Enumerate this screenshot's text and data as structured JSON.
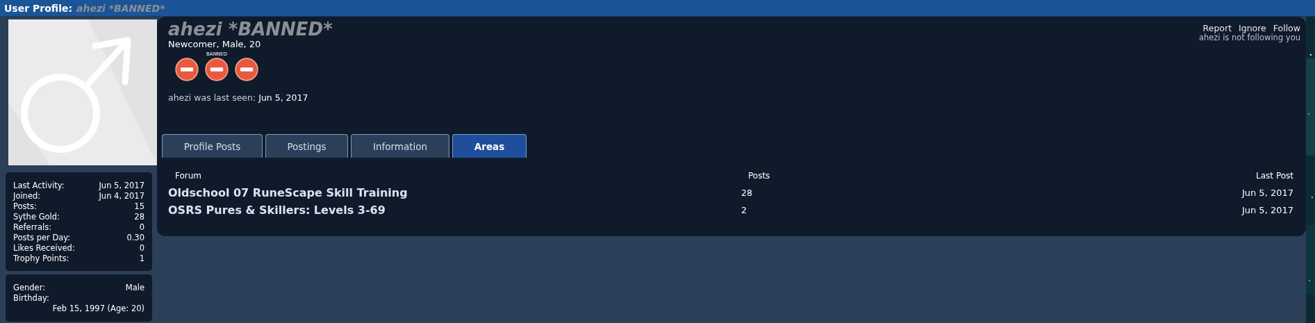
{
  "title_bar": {
    "label": "User Profile:",
    "name": "ahezi *BANNED*"
  },
  "stats": [
    {
      "label": "Last Activity:",
      "value": "Jun 5, 2017"
    },
    {
      "label": "Joined:",
      "value": "Jun 4, 2017"
    },
    {
      "label": "Posts:",
      "value": "15"
    },
    {
      "label": "Sythe Gold:",
      "value": "28"
    },
    {
      "label": "Referrals:",
      "value": "0"
    },
    {
      "label": "Posts per Day:",
      "value": "0.30"
    },
    {
      "label": "Likes Received:",
      "value": "0"
    },
    {
      "label": "Trophy Points:",
      "value": "1"
    }
  ],
  "details": {
    "gender_label": "Gender:",
    "gender": "Male",
    "birthday_label": "Birthday:",
    "birthday": "Feb 15, 1997 (Age: 20)"
  },
  "profile": {
    "username": "ahezi *BANNED*",
    "subtitle": "Newcomer, Male, 20",
    "badges": [
      {
        "kind": "ban"
      },
      {
        "kind": "ban",
        "caption": "BANNED"
      },
      {
        "kind": "ban"
      }
    ],
    "last_seen_label": "ahezi was last seen:",
    "last_seen": "Jun 5, 2017",
    "actions": [
      "Report",
      "Ignore",
      "Follow"
    ],
    "follow_status": "ahezi is not following you"
  },
  "tabs": [
    {
      "label": "Profile Posts",
      "selected": false
    },
    {
      "label": "Postings",
      "selected": false
    },
    {
      "label": "Information",
      "selected": false
    },
    {
      "label": "Areas",
      "selected": true
    }
  ],
  "table": {
    "columns": [
      "Forum",
      "Posts",
      "Last Post"
    ],
    "rows": [
      {
        "forum": "Oldschool 07 RuneScape Skill Training",
        "posts": "28",
        "last_post": "Jun 5, 2017"
      },
      {
        "forum": "OSRS Pures & Skillers: Levels 3-69",
        "posts": "2",
        "last_post": "Jun 5, 2017"
      }
    ]
  }
}
